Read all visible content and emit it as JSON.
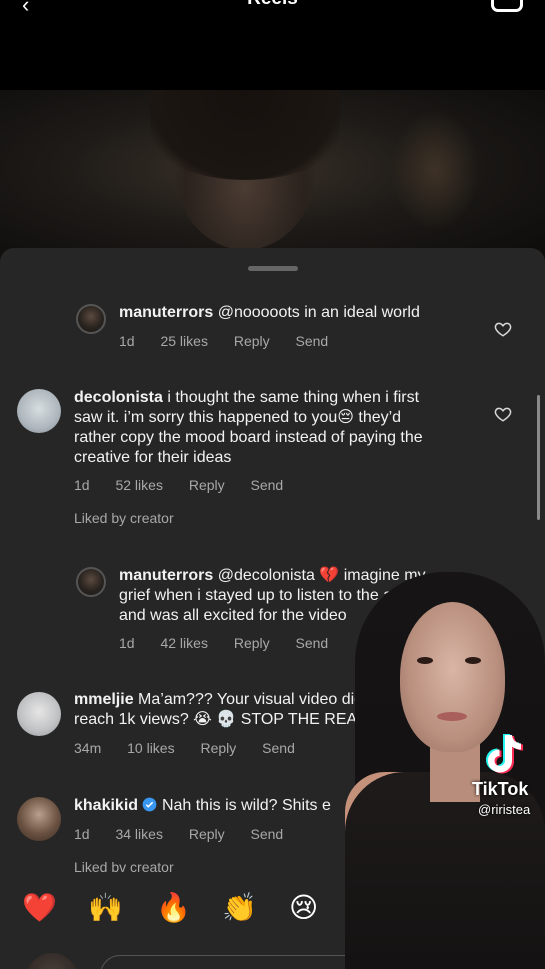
{
  "header": {
    "title": "Reels",
    "back_glyph": "‹"
  },
  "comments": [
    {
      "username": "manuterrors",
      "text": "@nooooots in an ideal world",
      "time": "1d",
      "likes": "25 likes",
      "reply": "Reply",
      "send": "Send"
    },
    {
      "username": "decolonista",
      "line1": "i thought the same thing when i first",
      "line2a": "saw it. i’m sorry this happened to you",
      "emoji": "😔",
      "line2b": " they’d",
      "line3": "rather copy the mood board instead of paying the",
      "line4": "creative for their ideas",
      "time": "1d",
      "likes": "52 likes",
      "reply": "Reply",
      "send": "Send",
      "liked_by": "Liked by creator"
    },
    {
      "username": "manuterrors",
      "line1a": "@decolonista",
      "emoji": "💔",
      "line1b": " imagine my",
      "line2": "grief when i stayed up to listen to the al",
      "line3": "and was all excited for the video",
      "time": "1d",
      "likes": "42 likes",
      "reply": "Reply",
      "send": "Send"
    },
    {
      "username": "mmeljie",
      "line1": "Ma’am??? Your visual video didn",
      "line2a": "reach 1k views?",
      "emoji1": "😭",
      "emoji2": "💀",
      "line2b": " STOP THE REACH",
      "time": "34m",
      "likes": "10 likes",
      "reply": "Reply",
      "send": "Send"
    },
    {
      "username": "khakikid",
      "text": "Nah this is wild? Shits e",
      "time": "1d",
      "likes": "34 likes",
      "reply": "Reply",
      "send": "Send",
      "liked_by": "Liked bv creator"
    }
  ],
  "reactions": [
    "❤️",
    "🙌",
    "🔥",
    "👏",
    "😢"
  ],
  "watermark": {
    "brand": "TikTok",
    "handle": "@riristea"
  },
  "colors": {
    "sheet": "#262626",
    "text": "#f2f2f2",
    "meta": "#a8a8a8",
    "verified": "#3897f0"
  }
}
